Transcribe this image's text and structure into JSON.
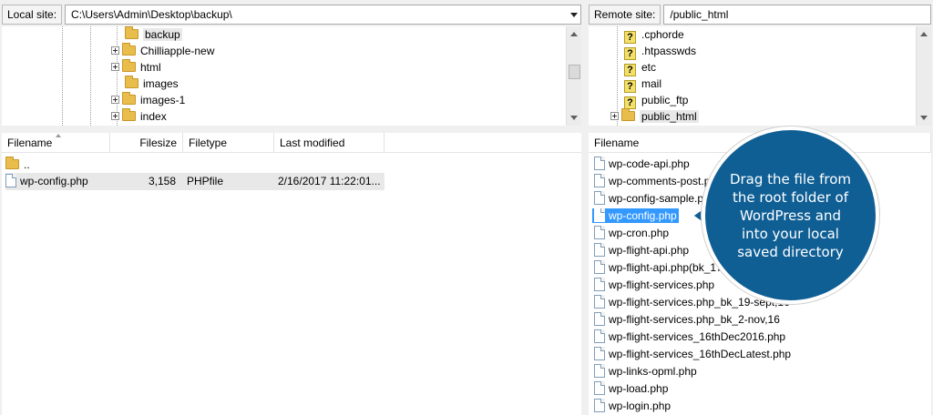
{
  "local": {
    "site_label": "Local site:",
    "path": "C:\\Users\\Admin\\Desktop\\backup\\",
    "tree": [
      {
        "label": "backup",
        "expander": false,
        "selected": true
      },
      {
        "label": "Chilliapple-new",
        "expander": true
      },
      {
        "label": "html",
        "expander": true
      },
      {
        "label": "images",
        "expander": false
      },
      {
        "label": "images-1",
        "expander": true
      },
      {
        "label": "index",
        "expander": true
      }
    ],
    "columns": {
      "filename": "Filename",
      "filesize": "Filesize",
      "filetype": "Filetype",
      "modified": "Last modified"
    },
    "parent_label": "..",
    "files": [
      {
        "name": "wp-config.php",
        "size": "3,158",
        "type": "PHPfile",
        "modified": "2/16/2017 11:22:01..."
      }
    ]
  },
  "remote": {
    "site_label": "Remote site:",
    "path": "/public_html",
    "tree": [
      {
        "label": ".cphorde",
        "icon": "question"
      },
      {
        "label": ".htpasswds",
        "icon": "question"
      },
      {
        "label": "etc",
        "icon": "question"
      },
      {
        "label": "mail",
        "icon": "question"
      },
      {
        "label": "public_ftp",
        "icon": "question"
      },
      {
        "label": "public_html",
        "icon": "folder",
        "expander": true,
        "selected": true
      }
    ],
    "columns": {
      "filename": "Filename"
    },
    "files": [
      "wp-code-api.php",
      "wp-comments-post.php",
      "wp-config-sample.php",
      "wp-config.php",
      "wp-cron.php",
      "wp-flight-api.php",
      "wp-flight-api.php(bk_17-sept,16",
      "wp-flight-services.php",
      "wp-flight-services.php_bk_19-sept,16",
      "wp-flight-services.php_bk_2-nov,16",
      "wp-flight-services_16thDec2016.php",
      "wp-flight-services_16thDecLatest.php",
      "wp-links-opml.php",
      "wp-load.php",
      "wp-login.php"
    ],
    "selected_file": "wp-config.php"
  },
  "callout": {
    "text": "Drag the file from the root folder of WordPress and into your local saved directory",
    "color": "#0f5f95"
  },
  "colors": {
    "selection_blue": "#3399ff",
    "folder": "#e9bd4c"
  }
}
